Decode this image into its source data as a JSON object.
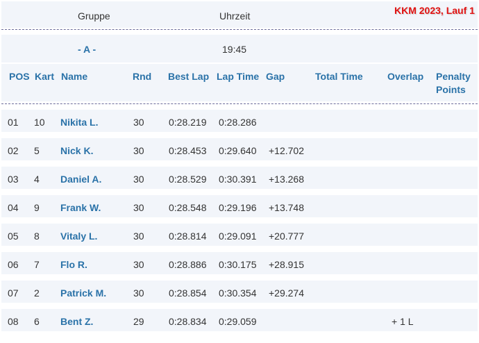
{
  "event_title": "KKM 2023, Lauf 1",
  "group_header": {
    "group_label": "Gruppe",
    "time_label": "Uhrzeit"
  },
  "group": {
    "name": "- A -",
    "time": "19:45"
  },
  "columns": {
    "pos": "POS",
    "kart": "Kart",
    "name": "Name",
    "rnd": "Rnd",
    "best_lap": "Best Lap",
    "lap_time": "Lap Time",
    "gap": "Gap",
    "total_time": "Total Time",
    "overlap": "Overlap",
    "penalty_line1": "Penalty",
    "penalty_line2": "Points"
  },
  "rows": [
    {
      "pos": "01",
      "kart": "10",
      "name": "Nikita L.",
      "rnd": "30",
      "best_lap": "0:28.219",
      "lap_time": "0:28.286",
      "gap": "",
      "total_time": "",
      "overlap": "",
      "penalty": ""
    },
    {
      "pos": "02",
      "kart": "5",
      "name": "Nick K.",
      "rnd": "30",
      "best_lap": "0:28.453",
      "lap_time": "0:29.640",
      "gap": "+12.702",
      "total_time": "",
      "overlap": "",
      "penalty": ""
    },
    {
      "pos": "03",
      "kart": "4",
      "name": "Daniel A.",
      "rnd": "30",
      "best_lap": "0:28.529",
      "lap_time": "0:30.391",
      "gap": "+13.268",
      "total_time": "",
      "overlap": "",
      "penalty": ""
    },
    {
      "pos": "04",
      "kart": "9",
      "name": "Frank W.",
      "rnd": "30",
      "best_lap": "0:28.548",
      "lap_time": "0:29.196",
      "gap": "+13.748",
      "total_time": "",
      "overlap": "",
      "penalty": ""
    },
    {
      "pos": "05",
      "kart": "8",
      "name": "Vitaly L.",
      "rnd": "30",
      "best_lap": "0:28.814",
      "lap_time": "0:29.091",
      "gap": "+20.777",
      "total_time": "",
      "overlap": "",
      "penalty": ""
    },
    {
      "pos": "06",
      "kart": "7",
      "name": "Flo R.",
      "rnd": "30",
      "best_lap": "0:28.886",
      "lap_time": "0:30.175",
      "gap": "+28.915",
      "total_time": "",
      "overlap": "",
      "penalty": ""
    },
    {
      "pos": "07",
      "kart": "2",
      "name": "Patrick M.",
      "rnd": "30",
      "best_lap": "0:28.854",
      "lap_time": "0:30.354",
      "gap": "+29.274",
      "total_time": "",
      "overlap": "",
      "penalty": ""
    },
    {
      "pos": "08",
      "kart": "6",
      "name": "Bent Z.",
      "rnd": "29",
      "best_lap": "0:28.834",
      "lap_time": "0:29.059",
      "gap": "",
      "total_time": "",
      "overlap": "+ 1 L",
      "penalty": ""
    }
  ],
  "colors": {
    "accent": "#2a72a8",
    "title": "#e01010",
    "band": "#f2f5fa",
    "divider": "#6a6a9a"
  }
}
